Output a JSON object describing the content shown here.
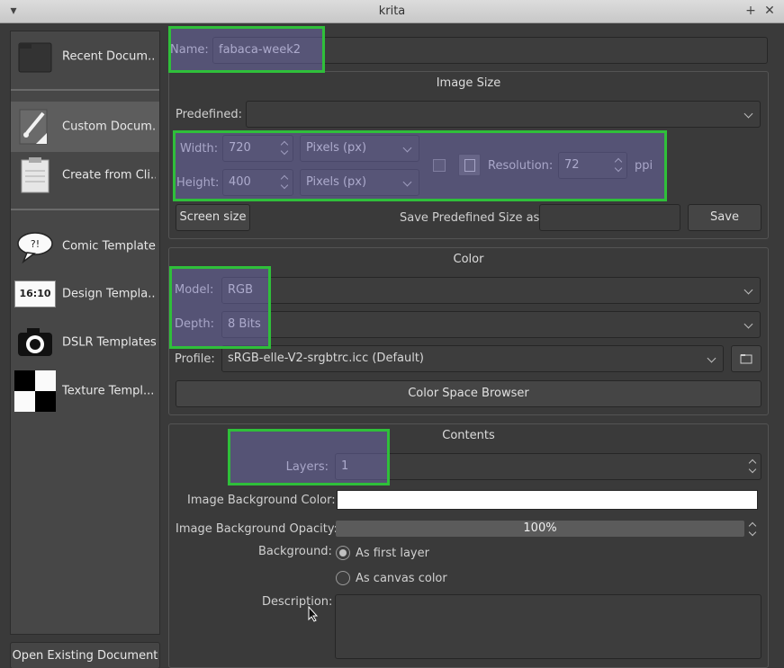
{
  "window": {
    "title": "krita"
  },
  "sidebar": {
    "items": [
      {
        "label": "Recent Docum...",
        "icon": "folder-icon"
      },
      {
        "label": "Custom Docum...",
        "icon": "brush-document-icon"
      },
      {
        "label": "Create from Cli...",
        "icon": "clipboard-icon"
      },
      {
        "label": "Comic Templates",
        "icon": "speech-bubble-icon"
      },
      {
        "label": "Design Templa...",
        "icon": "ratio-badge-icon",
        "badge": "16:10"
      },
      {
        "label": "DSLR Templates",
        "icon": "camera-icon"
      },
      {
        "label": "Texture Templ...",
        "icon": "checkerboard-icon"
      }
    ],
    "open_existing": "Open Existing Document"
  },
  "name_field": {
    "label": "Name:",
    "value": "fabaca-week2"
  },
  "image_size": {
    "title": "Image Size",
    "predefined_label": "Predefined:",
    "predefined_value": "",
    "width_label": "Width:",
    "width_value": "720",
    "width_unit": "Pixels (px)",
    "height_label": "Height:",
    "height_value": "400",
    "height_unit": "Pixels (px)",
    "resolution_label": "Resolution:",
    "resolution_value": "72",
    "resolution_unit": "ppi",
    "screen_size": "Screen size",
    "save_predefined_label": "Save Predefined Size as:",
    "save_predefined_value": "",
    "save": "Save"
  },
  "color": {
    "title": "Color",
    "model_label": "Model:",
    "model_value": "RGB",
    "depth_label": "Depth:",
    "depth_value": "8 Bits",
    "profile_label": "Profile:",
    "profile_value": "sRGB-elle-V2-srgbtrc.icc (Default)",
    "browser_button": "Color Space Browser"
  },
  "contents": {
    "title": "Contents",
    "layers_label": "Layers:",
    "layers_value": "1",
    "bg_color_label": "Image Background Color:",
    "bg_color": "#ffffff",
    "opacity_label": "Image Background Opacity:",
    "opacity_value": "100%",
    "background_label": "Background:",
    "bg_option_1": "As first layer",
    "bg_option_2": "As canvas color",
    "description_label": "Description:",
    "description_value": ""
  },
  "colors": {
    "highlight_border": "#2fbf3a",
    "highlight_fill": "#7873be"
  }
}
